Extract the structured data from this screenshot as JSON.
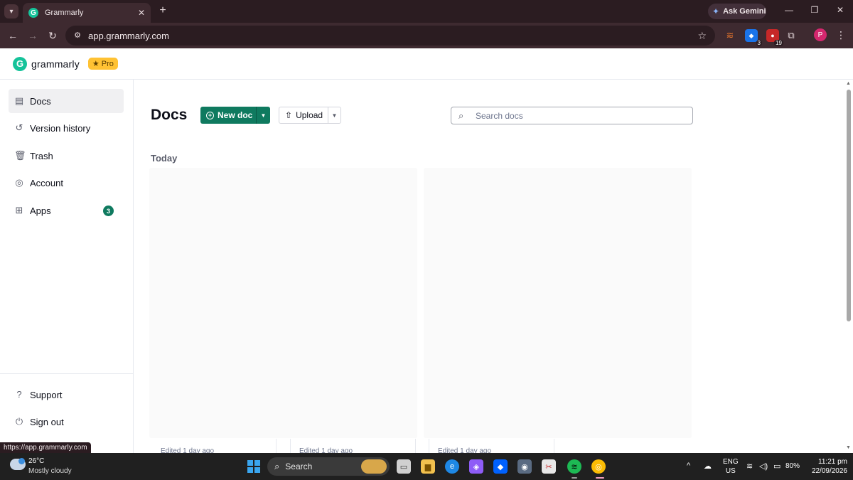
{
  "browser": {
    "tab_title": "Grammarly",
    "url": "app.grammarly.com",
    "ask_gemini_label": "Ask Gemini",
    "profile_initial": "P",
    "ext_badge_a": "3",
    "ext_badge_b": "19",
    "status_url": "https://app.grammarly.com"
  },
  "header": {
    "brand": "grammarly",
    "logo_letter": "G",
    "pro_label": "Pro"
  },
  "sidebar": {
    "items": [
      {
        "label": "Docs"
      },
      {
        "label": "Version history"
      },
      {
        "label": "Trash"
      },
      {
        "label": "Account"
      },
      {
        "label": "Apps",
        "badge": "3"
      }
    ],
    "footer": [
      {
        "label": "Support"
      },
      {
        "label": "Sign out"
      }
    ]
  },
  "main": {
    "title": "Docs",
    "new_doc_label": "New doc",
    "upload_label": "Upload",
    "search_placeholder": "Search docs",
    "section_today": "Today",
    "cards": [
      {
        "meta": "Edited 1 day ago"
      },
      {
        "meta": "Edited 1 day ago"
      },
      {
        "meta": "Edited 1 day ago"
      }
    ]
  },
  "taskbar": {
    "temperature": "26°C",
    "weather": "Mostly cloudy",
    "search_label": "Search",
    "lang_line1": "ENG",
    "lang_line2": "US",
    "battery": "80%",
    "time": "11:21 pm",
    "date": "22/09/2026"
  },
  "colors": {
    "accent": "#0f7a5f",
    "brand": "#15c39a",
    "pro": "#ffc233",
    "chrome_dark": "#2b1c21",
    "chrome_toolbar": "#3e2a30"
  }
}
